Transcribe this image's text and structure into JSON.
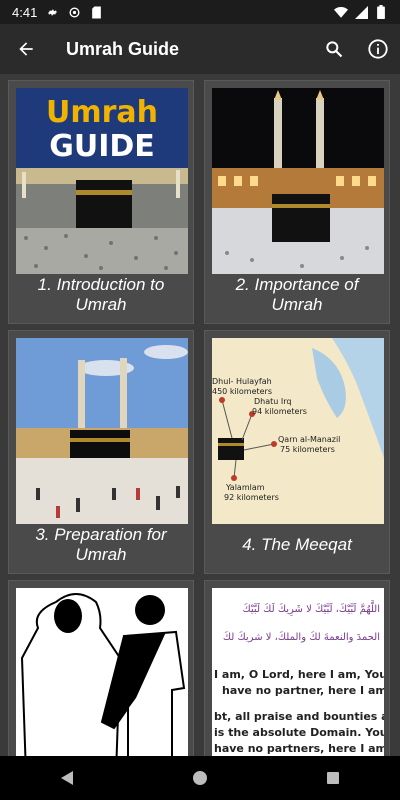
{
  "status_bar": {
    "time": "4:41",
    "left_icons": [
      "gear-icon",
      "badge-icon",
      "sd-card-icon"
    ],
    "right_icons": [
      "wifi-icon",
      "signal-icon",
      "battery-icon"
    ]
  },
  "app_bar": {
    "title": "Umrah Guide",
    "back_icon": "arrow-back-icon",
    "actions": [
      "search-icon",
      "info-icon"
    ]
  },
  "cards": [
    {
      "label": "1. Introduction to Umrah",
      "image": "umrah-guide-cover",
      "image_text_1": "Umrah",
      "image_text_2": "GUIDE"
    },
    {
      "label": "2. Importance of Umrah",
      "image": "kaaba-night"
    },
    {
      "label": "3. Preparation for Umrah",
      "image": "kaaba-day"
    },
    {
      "label": "4. The Meeqat",
      "image": "meeqat-map",
      "map_labels": [
        "Dhul- Hulayfah",
        "450 kilometers",
        "Dhatu Irq",
        "94 kilometers",
        "Qarn al-Manazil",
        "75 kilometers",
        "Yalamlam",
        "92 kilometers"
      ]
    },
    {
      "label": "",
      "image": "ihram-figures"
    },
    {
      "label": "",
      "image": "talbiyah-text",
      "arabic_lines": [
        "اللَّهُمَّ لَبَّيْكَ، لَبَّيْكَ لا شَرِيكَ لَكَ لَبَّيْكَ",
        "الحمدَ والنعمةَ لكَ والملكَ، لا شريكَ لكَ"
      ],
      "english_lines": [
        "I am, O Lord, here I am, You",
        "have no partner, here I am.",
        "bt, all praise and bounties are",
        "is the absolute Domain. You",
        "have no partners, here I am\""
      ]
    }
  ],
  "nav_bar": {
    "buttons": [
      "back-triangle-icon",
      "home-circle-icon",
      "recents-square-icon"
    ]
  }
}
